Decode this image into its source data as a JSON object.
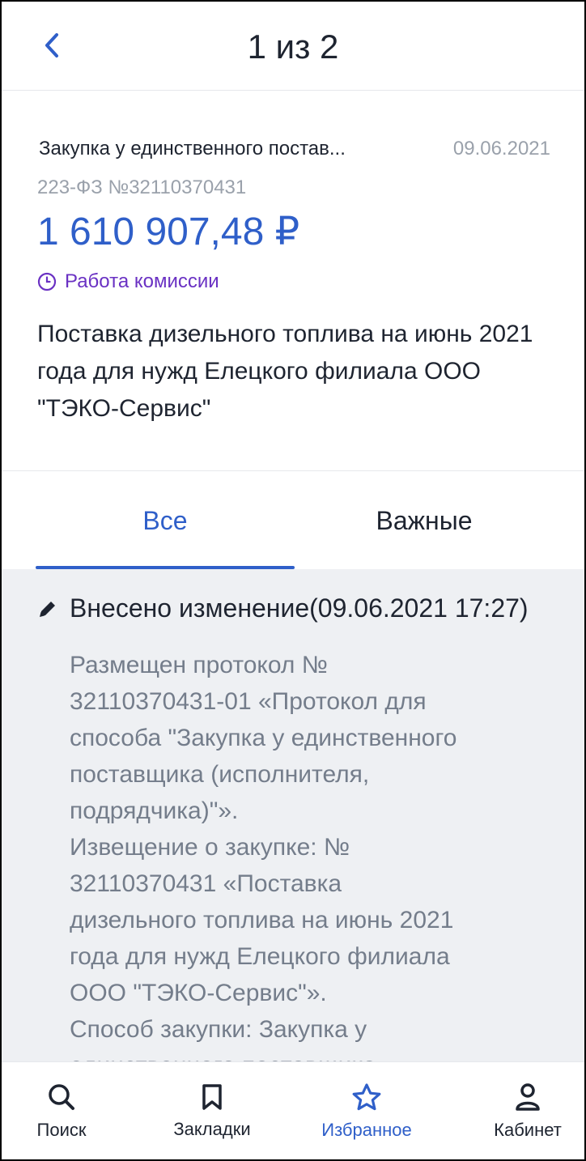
{
  "header": {
    "title": "1 из 2"
  },
  "card": {
    "kind": "Закупка у единственного постав...",
    "date": "09.06.2021",
    "regnum": "223-ФЗ №32110370431",
    "price": "1 610 907,48 ₽",
    "status": "Работа комиссии",
    "description": "Поставка дизельного топлива на июнь 2021 года для нужд Елецкого филиала ООО \"ТЭКО-Сервис\""
  },
  "tabs": [
    {
      "label": "Все",
      "active": true
    },
    {
      "label": "Важные",
      "active": false
    }
  ],
  "event": {
    "title": "Внесено изменение(09.06.2021 17:27)",
    "lines": [
      "Размещен протокол №",
      "32110370431-01 «Протокол для",
      "способа \"Закупка у единственного",
      "поставщика (исполнителя,",
      "подрядчика)\"».",
      "Извещение о закупке: №",
      "32110370431 «Поставка",
      "дизельного топлива на июнь 2021",
      "года для нужд Елецкого филиала",
      "ООО \"ТЭКО-Сервис\"».",
      "Способ закупки: Закупка у",
      "единственного поставщика"
    ]
  },
  "bottom_nav": {
    "search": "Поиск",
    "bookmarks": "Закладки",
    "favorites": "Избранное",
    "cabinet": "Кабинет"
  },
  "colors": {
    "accent": "#2f5fc9",
    "status": "#6a31c3",
    "muted": "#9aa1ab",
    "feed_bg": "#eef0f3"
  },
  "icons": {
    "back": "chevron-left-icon",
    "status": "clock-icon",
    "event": "pencil-icon",
    "search": "search-icon",
    "bookmarks": "bookmark-icon",
    "favorites": "star-icon",
    "cabinet": "user-icon"
  }
}
